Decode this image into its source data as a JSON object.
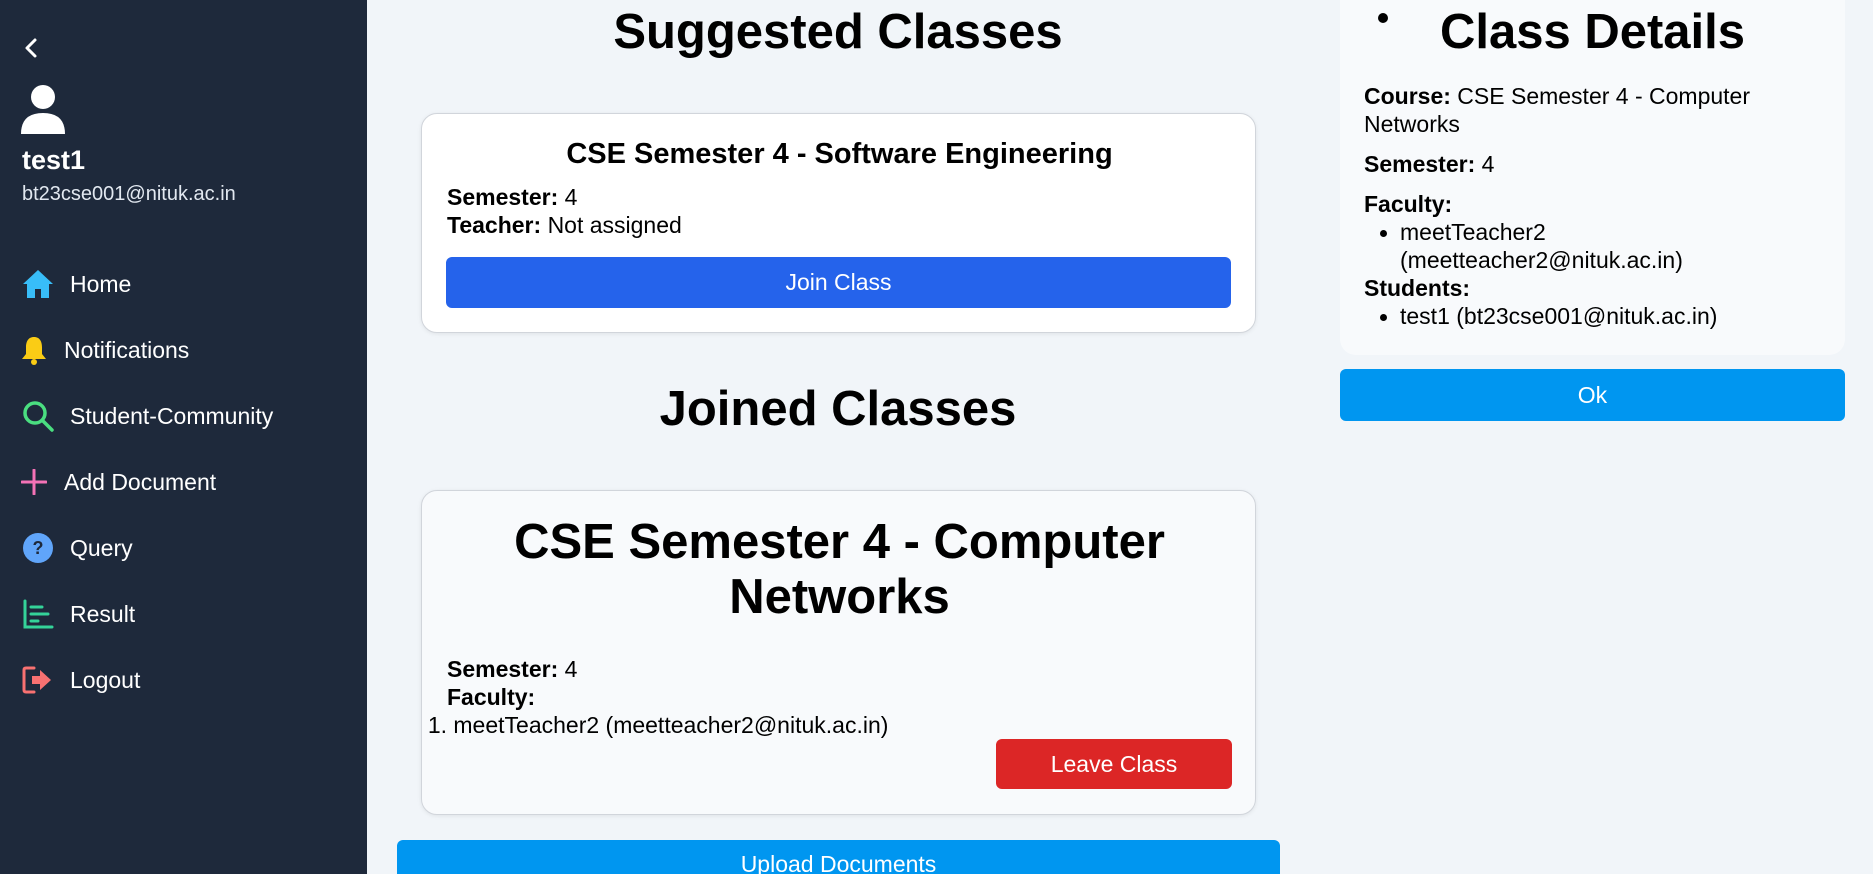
{
  "sidebar": {
    "user_name": "test1",
    "user_email": "bt23cse001@nituk.ac.in",
    "nav": [
      {
        "label": "Home",
        "icon": "home-icon",
        "color": "#38bdf8"
      },
      {
        "label": "Notifications",
        "icon": "bell-icon",
        "color": "#facc15"
      },
      {
        "label": "Student-Community",
        "icon": "search-icon",
        "color": "#4ade80"
      },
      {
        "label": "Add Document",
        "icon": "plus-icon",
        "color": "#f472b6"
      },
      {
        "label": "Query",
        "icon": "question-icon",
        "color": "#60a5fa"
      },
      {
        "label": "Result",
        "icon": "chart-icon",
        "color": "#34d399"
      },
      {
        "label": "Logout",
        "icon": "logout-icon",
        "color": "#f87171"
      }
    ]
  },
  "suggested": {
    "heading": "Suggested Classes",
    "card": {
      "title": "CSE Semester 4 - Software Engineering",
      "semester_label": "Semester:",
      "semester_value": "4",
      "teacher_label": "Teacher:",
      "teacher_value": "Not assigned",
      "button": "Join Class"
    }
  },
  "joined": {
    "heading": "Joined Classes",
    "card": {
      "title_line1": "CSE Semester 4 - Computer",
      "title_line2": "Networks",
      "semester_label": "Semester:",
      "semester_value": "4",
      "faculty_label": "Faculty:",
      "faculty_number": "1.",
      "faculty_item": "meetTeacher2 (meetteacher2@nituk.ac.in)",
      "button": "Leave Class"
    },
    "upload_button": "Upload Documents"
  },
  "details": {
    "heading": "Class Details",
    "course_label": "Course:",
    "course_line1": "CSE Semester 4 - Computer",
    "course_line2": "Networks",
    "semester_label": "Semester:",
    "semester_value": "4",
    "faculty_label": "Faculty:",
    "faculty_line1": "meetTeacher2",
    "faculty_line2": "(meetteacher2@nituk.ac.in)",
    "students_label": "Students:",
    "student_item": "test1 (bt23cse001@nituk.ac.in)",
    "ok_button": "Ok"
  },
  "colors": {
    "sidebar_bg": "#1e293b",
    "join_button": "#2563eb",
    "leave_button": "#dc2626",
    "upload_button": "#0096f0",
    "ok_button": "#0096f0"
  }
}
